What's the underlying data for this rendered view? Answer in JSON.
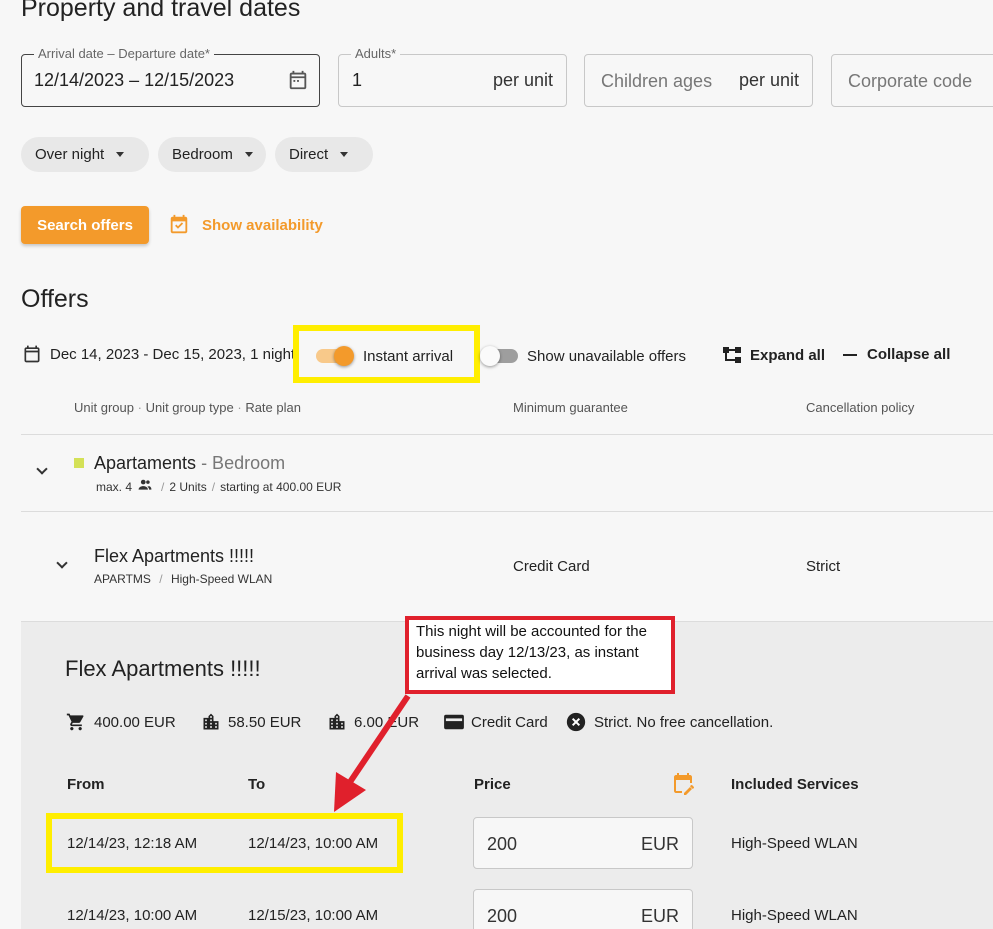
{
  "header": {
    "title": "Property and travel dates"
  },
  "form": {
    "dates": {
      "label": "Arrival date – Departure date*",
      "value": "12/14/2023 – 12/15/2023"
    },
    "adults": {
      "label": "Adults*",
      "value": "1",
      "suffix": "per unit"
    },
    "children": {
      "placeholder": "Children ages",
      "suffix": "per unit"
    },
    "corporate": {
      "placeholder": "Corporate code"
    },
    "chips": [
      "Over night",
      "Bedroom",
      "Direct"
    ],
    "search_label": "Search offers",
    "availability_label": "Show availability"
  },
  "offers": {
    "title": "Offers",
    "date_range": "Dec 14, 2023 - Dec 15, 2023, 1 night",
    "instant_arrival_label": "Instant arrival",
    "instant_arrival_on": true,
    "show_unavailable_label": "Show unavailable offers",
    "show_unavailable_on": false,
    "expand_all": "Expand all",
    "collapse_all": "Collapse all",
    "columns": {
      "unit_group": "Unit group",
      "unit_group_type": "Unit group type",
      "rate_plan": "Rate plan",
      "minimum_guarantee": "Minimum guarantee",
      "cancellation_policy": "Cancellation policy"
    },
    "group": {
      "name": "Apartaments",
      "type": " - Bedroom",
      "max": "max. 4",
      "units": "2 Units",
      "starting": "starting at 400.00 EUR",
      "color": "#d4e157"
    },
    "rate": {
      "name": "Flex Apartments !!!!!",
      "code": "APARTMS",
      "service": "High-Speed WLAN",
      "guarantee": "Credit Card",
      "cancellation": "Strict"
    },
    "detail": {
      "title": "Flex Apartments !!!!!",
      "total": "400.00 EUR",
      "tax1": "58.50 EUR",
      "tax2": "6.00 EUR",
      "guarantee": "Credit Card",
      "cancellation": "Strict. No free cancellation.",
      "headers": {
        "from": "From",
        "to": "To",
        "price": "Price",
        "services": "Included Services"
      },
      "rows": [
        {
          "from": "12/14/23, 12:18 AM",
          "to": "12/14/23, 10:00 AM",
          "price": "200",
          "currency": "EUR",
          "service": "High-Speed WLAN"
        },
        {
          "from": "12/14/23, 10:00 AM",
          "to": "12/15/23, 10:00 AM",
          "price": "200",
          "currency": "EUR",
          "service": "High-Speed WLAN"
        }
      ]
    }
  },
  "annotation": {
    "text": "This night will be accounted for the business day 12/13/23, as instant arrival was selected."
  },
  "colors": {
    "accent": "#f39a2b",
    "highlight": "#ffee00",
    "callout_border": "#e0202c"
  },
  "icons": [
    "calendar-icon",
    "calendar-check-icon",
    "calendar-edit-icon",
    "people-icon",
    "tree-expand-icon",
    "minus-icon",
    "chevron-down-icon",
    "cart-icon",
    "city-icon",
    "credit-card-icon",
    "cancel-circle-icon",
    "arrow-icon"
  ]
}
